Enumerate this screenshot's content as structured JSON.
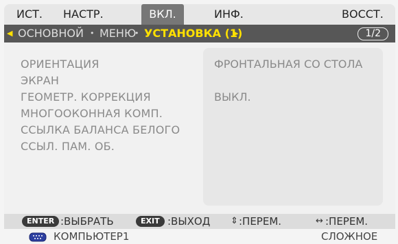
{
  "tabs": [
    "ИСТ.",
    "НАСТР.",
    "ВКЛ.",
    "ИНФ.",
    "ВОССТ."
  ],
  "breadcrumb": {
    "left_arrow": "◀",
    "items": [
      "ОСНОВНОЙ",
      "МЕНЮ",
      "УСТАНОВКА (1)"
    ],
    "separator": "•",
    "right_arrow": "▶",
    "page": "1/2"
  },
  "menu_items": [
    "ОРИЕНТАЦИЯ",
    "ЭКРАН",
    "ГЕОМЕТР. КОРРЕКЦИЯ",
    "МНОГООКОННАЯ КОМП.",
    "ССЫЛКА БАЛАНСА БЕЛОГО",
    "ССЫЛ. ПАМ. ОБ."
  ],
  "values": [
    "ФРОНТАЛЬНАЯ СО СТОЛА",
    "ВЫКЛ."
  ],
  "help": {
    "enter_key": "ENTER",
    "enter_text": ":ВЫБРАТЬ",
    "exit_key": "EXIT",
    "exit_text": ":ВЫХОД",
    "updown_icon": "⇕",
    "updown_text": ":ПЕРЕМ.",
    "leftright_icon": "↔",
    "leftright_text": ":ПЕРЕМ."
  },
  "status": {
    "source": "КОМПЬЮТЕР1",
    "mode": "СЛОЖНОЕ"
  },
  "colors": {
    "active_tab": "#777777",
    "breadcrumb_bar": "#575757",
    "highlight": "#ffe000"
  }
}
